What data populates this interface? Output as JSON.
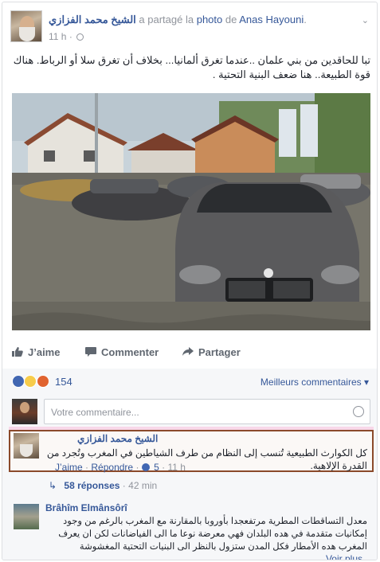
{
  "post": {
    "author": "الشيخ محمد الفزازي",
    "shared_text": "a partagé la",
    "photo_word": "photo",
    "of_word": "de",
    "original_author": "Anas Hayouni",
    "time": "11 h",
    "text": "تبا للحاقدين من بني علمان ..عندما تغرق ألمانيا... بخلاف أن تغرق سلا أو الرباط. هناك قوة الطبيعة.. هنا ضعف البنية التحتية ."
  },
  "actions": {
    "like": "J’aime",
    "comment": "Commenter",
    "share": "Partager"
  },
  "reactions": {
    "count": "154",
    "sort_label": "Meilleurs commentaires"
  },
  "composer": {
    "placeholder": "Votre commentaire..."
  },
  "comment1": {
    "author": "الشيخ محمد الفزازي",
    "text": "كل الكوارث الطبيعية تُنسب إلى النظام من طرف الشياطين في المغرب وتُجرد من القدرة الإلاهية.",
    "like": "J’aime",
    "reply": "Répondre",
    "likes": "5",
    "time": "11 h"
  },
  "replies": {
    "label": "58 réponses",
    "time": "42 min"
  },
  "comment2": {
    "author": "Brâhîm Elmânsôrî",
    "text": "معدل التساقطات المطرية مرتفعجدا بأوروبا بالمقارنة مع المغرب بالرغم من وجود إمكانيات متقدمة في هده البلدان فهي معرضة نوعا ما الى الفياضانات لكن ان يعرف المغرب هده الأمطار فكل المدن ستزول بالنظر الى البنيات التحتية المغشوشة",
    "more": "Voir plus"
  },
  "colors": {
    "link": "#365899",
    "muted": "#90949c",
    "highlight_border": "#8b4a2b"
  }
}
